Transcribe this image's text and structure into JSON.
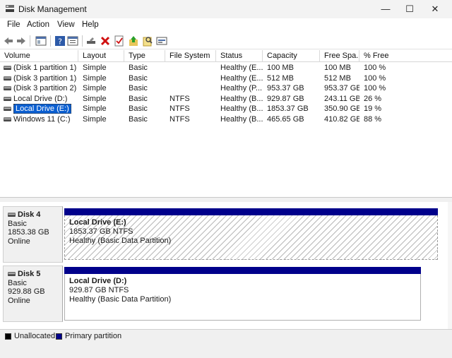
{
  "window": {
    "title": "Disk Management",
    "minimize": "—",
    "maximize": "☐",
    "close": "✕"
  },
  "menu": [
    "File",
    "Action",
    "View",
    "Help"
  ],
  "toolbar": [
    "back-icon",
    "forward-icon",
    "console-tree-icon",
    "help-icon",
    "properties-icon",
    "connect-icon",
    "delete-icon",
    "check-icon",
    "up-arrow-icon",
    "search-icon",
    "rescan-icon"
  ],
  "columns": [
    "Volume",
    "Layout",
    "Type",
    "File System",
    "Status",
    "Capacity",
    "Free Spa...",
    "% Free"
  ],
  "volumes": [
    {
      "volume": "(Disk 1 partition 1)",
      "layout": "Simple",
      "type": "Basic",
      "fs": "",
      "status": "Healthy (E...",
      "capacity": "100 MB",
      "free": "100 MB",
      "pct": "100 %"
    },
    {
      "volume": "(Disk 3 partition 1)",
      "layout": "Simple",
      "type": "Basic",
      "fs": "",
      "status": "Healthy (E...",
      "capacity": "512 MB",
      "free": "512 MB",
      "pct": "100 %"
    },
    {
      "volume": "(Disk 3 partition 2)",
      "layout": "Simple",
      "type": "Basic",
      "fs": "",
      "status": "Healthy (P...",
      "capacity": "953.37 GB",
      "free": "953.37 GB",
      "pct": "100 %"
    },
    {
      "volume": "Local Drive (D:)",
      "layout": "Simple",
      "type": "Basic",
      "fs": "NTFS",
      "status": "Healthy (B...",
      "capacity": "929.87 GB",
      "free": "243.11 GB",
      "pct": "26 %"
    },
    {
      "volume": "Local Drive (E:)",
      "layout": "Simple",
      "type": "Basic",
      "fs": "NTFS",
      "status": "Healthy (B...",
      "capacity": "1853.37 GB",
      "free": "350.90 GB",
      "pct": "19 %"
    },
    {
      "volume": "Windows 11 (C:)",
      "layout": "Simple",
      "type": "Basic",
      "fs": "NTFS",
      "status": "Healthy (B...",
      "capacity": "465.65 GB",
      "free": "410.82 GB",
      "pct": "88 %"
    }
  ],
  "selected_row_index": 4,
  "disks": [
    {
      "name": "Disk 4",
      "type": "Basic",
      "size": "1853.38 GB",
      "state": "Online",
      "partition": {
        "title": "Local Drive  (E:)",
        "size": "1853.37 GB NTFS",
        "status": "Healthy (Basic Data Partition)",
        "selected": true
      }
    },
    {
      "name": "Disk 5",
      "type": "Basic",
      "size": "929.88 GB",
      "state": "Online",
      "partition": {
        "title": "Local Drive  (D:)",
        "size": "929.87 GB NTFS",
        "status": "Healthy (Basic Data Partition)",
        "selected": false
      }
    }
  ],
  "legend": [
    {
      "label": "Unallocated",
      "color": "#000000"
    },
    {
      "label": "Primary partition",
      "color": "#00008b"
    }
  ]
}
